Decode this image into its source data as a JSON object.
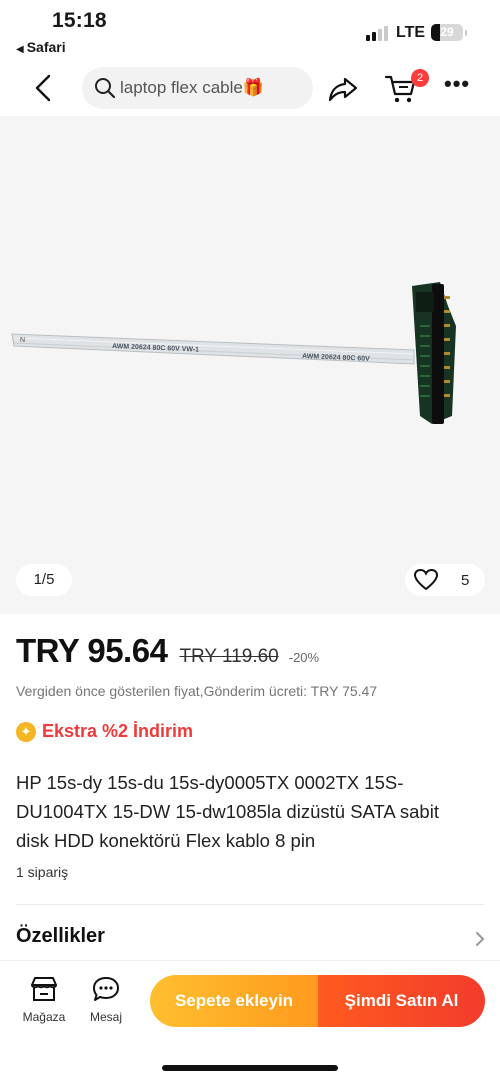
{
  "status_bar": {
    "time": "15:18",
    "back_app": "Safari",
    "network": "LTE",
    "battery": "29"
  },
  "header": {
    "search_query": "laptop flex cable",
    "search_emoji": "🎁",
    "cart_count": "2"
  },
  "gallery": {
    "counter": "1/5",
    "wishlist_count": "5",
    "cable_print_1": "AWM 20624 80C 60V VW-1",
    "cable_print_2": "AWM 20624 80C 60V",
    "cable_edge_mark": "N"
  },
  "product": {
    "price": "TRY 95.64",
    "original_price": "TRY 119.60",
    "discount": "-20%",
    "shipping_note": "Vergiden önce gösterilen fiyat,Gönderim ücreti: TRY 75.47",
    "extra_discount": "Ekstra %2 İndirim",
    "title": "HP 15s-dy 15s-du 15s-dy0005TX 0002TX 15S-DU1004TX 15-DW 15-dw1085la dizüstü SATA sabit disk HDD konektörü Flex kablo 8 pin",
    "orders": "1 sipariş",
    "specs_heading": "Özellikler"
  },
  "bottom_bar": {
    "store_label": "Mağaza",
    "message_label": "Mesaj",
    "add_to_cart": "Sepete ekleyin",
    "buy_now": "Şimdi Satın Al"
  },
  "colors": {
    "price_red": "#ef3a3a",
    "cart_orange": "#ffb02a",
    "buy_red": "#f23c2c",
    "badge_red": "#ff3b3b"
  },
  "icons": [
    "back-icon",
    "search-icon",
    "share-icon",
    "cart-icon",
    "more-icon",
    "heart-icon",
    "store-icon",
    "message-icon",
    "chevron-right-icon"
  ]
}
